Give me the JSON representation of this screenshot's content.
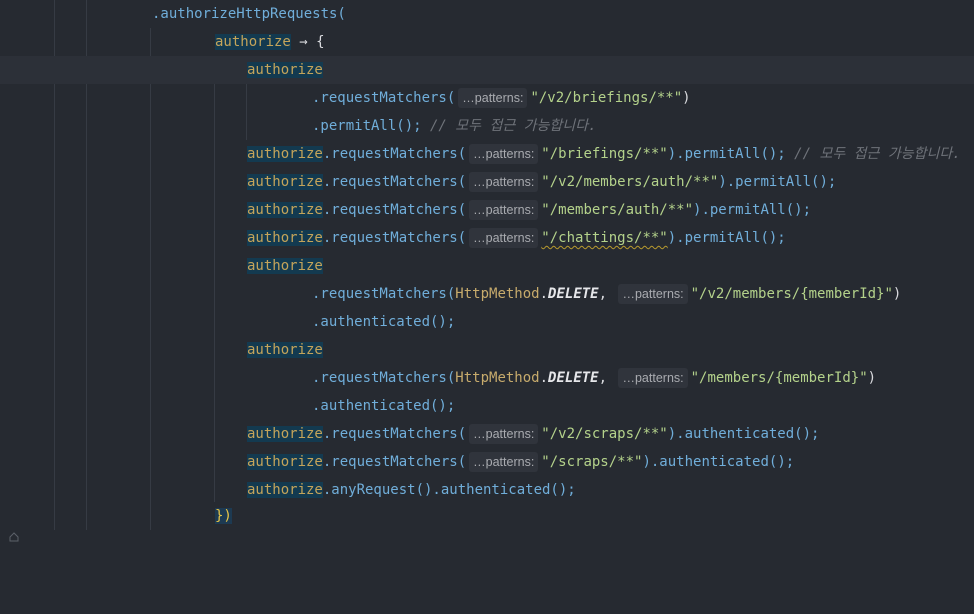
{
  "editor": {
    "lines": [
      {
        "id": "l0",
        "parts": [
          ".authorizeHttpRequests("
        ]
      },
      {
        "id": "l1",
        "parts": [
          "authorize",
          " → ",
          "{"
        ]
      },
      {
        "id": "l2",
        "parts": [
          "authorize"
        ]
      },
      {
        "id": "l3",
        "parts": [
          ".requestMatchers(",
          "…patterns:",
          "\"/v2/briefings/**\"",
          ")"
        ]
      },
      {
        "id": "l4",
        "parts": [
          ".permitAll();",
          " // 모두 접근 가능합니다."
        ]
      },
      {
        "id": "l5",
        "parts": [
          "authorize",
          ".requestMatchers(",
          "…patterns:",
          "\"/briefings/**\"",
          ").permitAll();",
          " // 모두 접근 가능합니다."
        ]
      },
      {
        "id": "l6",
        "parts": [
          "authorize",
          ".requestMatchers(",
          "…patterns:",
          "\"/v2/members/auth/**\"",
          ").permitAll();"
        ]
      },
      {
        "id": "l7",
        "parts": [
          "authorize",
          ".requestMatchers(",
          "…patterns:",
          "\"/members/auth/**\"",
          ").permitAll();"
        ]
      },
      {
        "id": "l8",
        "parts": [
          "authorize",
          ".requestMatchers(",
          "…patterns:",
          "\"/chattings/**\"",
          ").permitAll();"
        ]
      },
      {
        "id": "l9",
        "parts": [
          "authorize"
        ]
      },
      {
        "id": "l10",
        "parts": [
          ".requestMatchers(",
          "HttpMethod",
          ".",
          "DELETE",
          ",",
          "…patterns:",
          "\"/v2/members/{memberId}\"",
          ")"
        ]
      },
      {
        "id": "l11",
        "parts": [
          ".authenticated();"
        ]
      },
      {
        "id": "l12",
        "parts": [
          "authorize"
        ]
      },
      {
        "id": "l13",
        "parts": [
          ".requestMatchers(",
          "HttpMethod",
          ".",
          "DELETE",
          ",",
          "…patterns:",
          "\"/members/{memberId}\"",
          ")"
        ]
      },
      {
        "id": "l14",
        "parts": [
          ".authenticated();"
        ]
      },
      {
        "id": "l15",
        "parts": [
          "authorize",
          ".requestMatchers(",
          "…patterns:",
          "\"/v2/scraps/**\"",
          ").authenticated();"
        ]
      },
      {
        "id": "l16",
        "parts": [
          "authorize",
          ".requestMatchers(",
          "…patterns:",
          "\"/scraps/**\"",
          ").authenticated();"
        ]
      },
      {
        "id": "l17",
        "parts": [
          "authorize",
          ".anyRequest().authenticated();"
        ]
      },
      {
        "id": "l18",
        "parts": [
          "})"
        ]
      }
    ]
  },
  "colors": {
    "background": "#262a31",
    "current_line": "#2c3038",
    "identifier_highlight": "#133a50",
    "string": "#b4d28b",
    "method": "#70aeda",
    "comment": "#6f737a"
  },
  "icons": [
    "fold-icon",
    "fold-end-icon"
  ]
}
